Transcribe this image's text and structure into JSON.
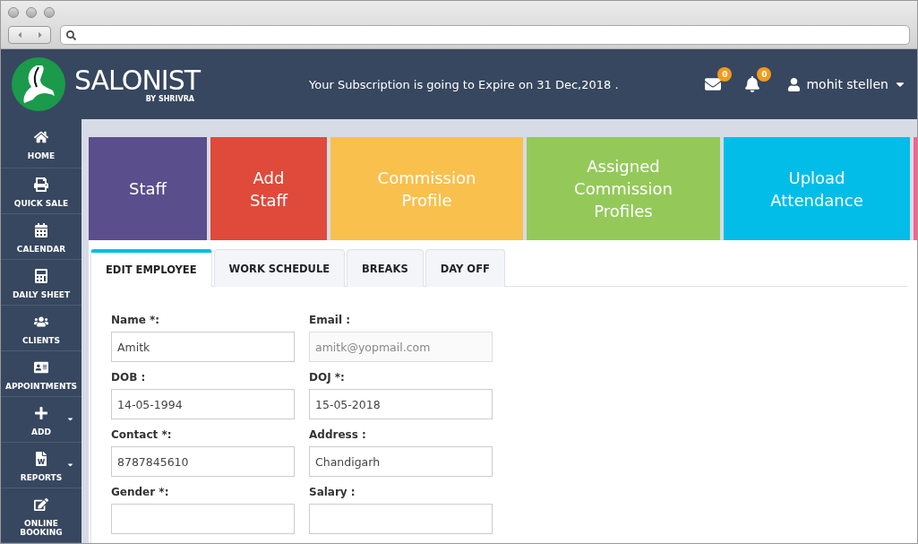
{
  "brand": {
    "name": "SALONIST",
    "tagline": "BY SHRIVRA"
  },
  "header": {
    "notice": "Your Subscription is going to Expire on 31 Dec,2018 .",
    "mail_count": "0",
    "alert_count": "0",
    "user": "mohit stellen"
  },
  "sidebar": {
    "items": [
      {
        "label": "HOME",
        "has_menu": false
      },
      {
        "label": "QUICK SALE",
        "has_menu": false
      },
      {
        "label": "CALENDAR",
        "has_menu": false
      },
      {
        "label": "DAILY SHEET",
        "has_menu": false
      },
      {
        "label": "CLIENTS",
        "has_menu": false
      },
      {
        "label": "APPOINTMENTS",
        "has_menu": false
      },
      {
        "label": "ADD",
        "has_menu": true
      },
      {
        "label": "REPORTS",
        "has_menu": true
      },
      {
        "label": "ONLINE BOOKING",
        "has_menu": false
      }
    ]
  },
  "tiles": [
    {
      "label": "Staff",
      "color": "#5b4e8c"
    },
    {
      "label": "Add Staff",
      "color": "#e04a3b"
    },
    {
      "label": "Commission Profile",
      "color": "#f9c04e"
    },
    {
      "label": "Assigned Commission Profiles",
      "color": "#94c95a"
    },
    {
      "label": "Upload Attendance",
      "color": "#03bde9"
    }
  ],
  "tabs": [
    {
      "label": "EDIT EMPLOYEE",
      "selected": true
    },
    {
      "label": "WORK SCHEDULE",
      "selected": false
    },
    {
      "label": "BREAKS",
      "selected": false
    },
    {
      "label": "DAY OFF",
      "selected": false
    }
  ],
  "form": {
    "fields": [
      {
        "label": "Name *:",
        "value": "Amitk",
        "disabled": false
      },
      {
        "label": "Email :",
        "value": "amitk@yopmail.com",
        "disabled": true
      },
      {
        "label": "DOB :",
        "value": "14-05-1994",
        "disabled": false
      },
      {
        "label": "DOJ *:",
        "value": "15-05-2018",
        "disabled": false
      },
      {
        "label": "Contact *:",
        "value": "8787845610",
        "disabled": false
      },
      {
        "label": "Address :",
        "value": "Chandigarh",
        "disabled": false
      },
      {
        "label": "Gender *:",
        "disabled": false
      },
      {
        "label": "Salary :",
        "disabled": false
      }
    ]
  }
}
